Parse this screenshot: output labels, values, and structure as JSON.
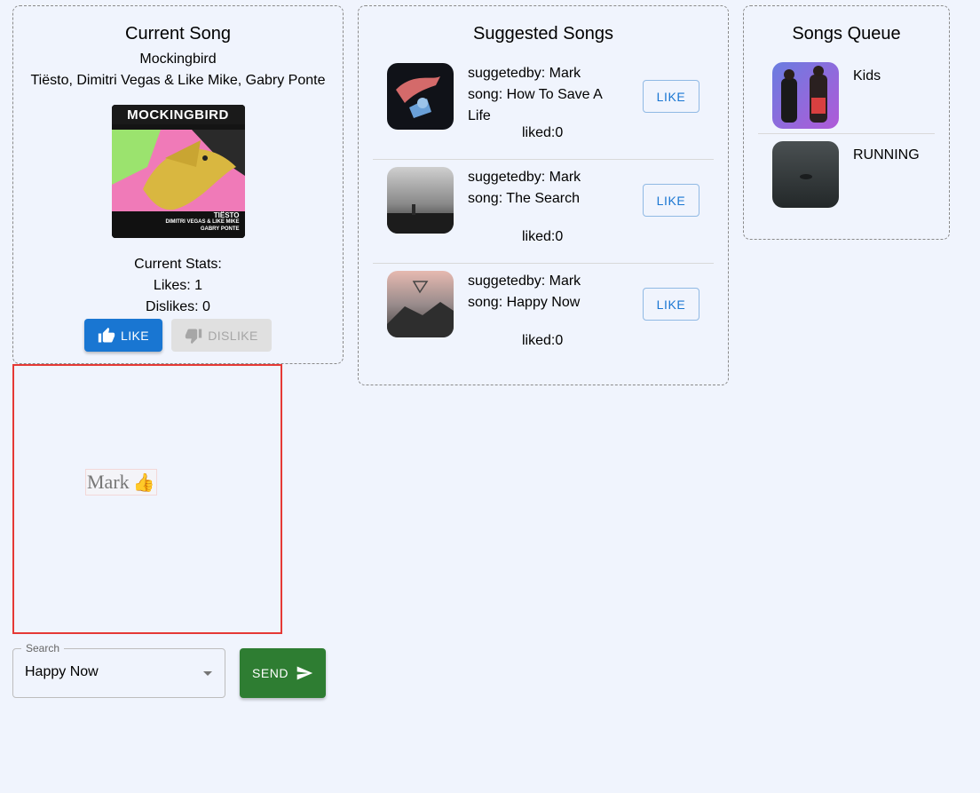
{
  "current_song": {
    "heading": "Current Song",
    "title": "Mockingbird",
    "artists": "Tiësto, Dimitri Vegas & Like Mike, Gabry Ponte",
    "cover": {
      "title_text": "MOCKINGBIRD",
      "artist_line1": "TIËSTO",
      "artist_line2": "DIMITRI VEGAS & LIKE MIKE",
      "artist_line3": "GABRY PONTE"
    },
    "stats_label": "Current Stats:",
    "likes_text": "Likes: 1",
    "dislikes_text": "Dislikes: 0",
    "like_button": "LIKE",
    "dislike_button": "DISLIKE"
  },
  "suggested": {
    "heading": "Suggested Songs",
    "items": [
      {
        "suggested_by": "suggetedby: Mark",
        "song": "song: How To Save A Life",
        "liked": "liked:0",
        "button": "LIKE"
      },
      {
        "suggested_by": "suggetedby: Mark",
        "song": "song: The Search",
        "liked": "liked:0",
        "button": "LIKE"
      },
      {
        "suggested_by": "suggetedby: Mark",
        "song": "song: Happy Now",
        "liked": "liked:0",
        "button": "LIKE"
      }
    ]
  },
  "queue": {
    "heading": "Songs Queue",
    "items": [
      {
        "title": "Kids"
      },
      {
        "title": "RUNNING"
      }
    ]
  },
  "reaction": {
    "user": "Mark",
    "emoji": "👍"
  },
  "search": {
    "label": "Search",
    "value": "Happy Now"
  },
  "send_button": "SEND",
  "colors": {
    "primary": "#1976d2",
    "success": "#2e7d32",
    "reaction_border": "#e53935",
    "background": "#f0f4fd"
  }
}
